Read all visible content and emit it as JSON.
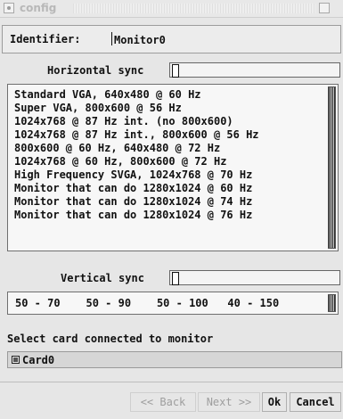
{
  "window": {
    "title": "config"
  },
  "identifier": {
    "label": "Identifier:",
    "value": "Monitor0"
  },
  "horizontal_sync": {
    "label": "Horizontal sync",
    "value": "",
    "options": [
      "Standard VGA, 640x480 @ 60 Hz",
      "Super VGA, 800x600 @ 56 Hz",
      "1024x768 @ 87 Hz int. (no 800x600)",
      "1024x768 @ 87 Hz int., 800x600 @ 56 Hz",
      "800x600 @ 60 Hz, 640x480 @ 72 Hz",
      "1024x768 @ 60 Hz, 800x600 @ 72 Hz",
      "High Frequency SVGA, 1024x768 @ 70 Hz",
      "Monitor that can do 1280x1024 @ 60 Hz",
      "Monitor that can do 1280x1024 @ 74 Hz",
      "Monitor that can do 1280x1024 @ 76 Hz"
    ]
  },
  "vertical_sync": {
    "label": "Vertical sync",
    "value": "",
    "options_text": "50 - 70    50 - 90    50 - 100   40 - 150"
  },
  "card": {
    "prompt": "Select card connected to monitor",
    "label": "Card0"
  },
  "buttons": {
    "back": "<< Back",
    "next": "Next >>",
    "ok": "Ok",
    "cancel": "Cancel"
  }
}
